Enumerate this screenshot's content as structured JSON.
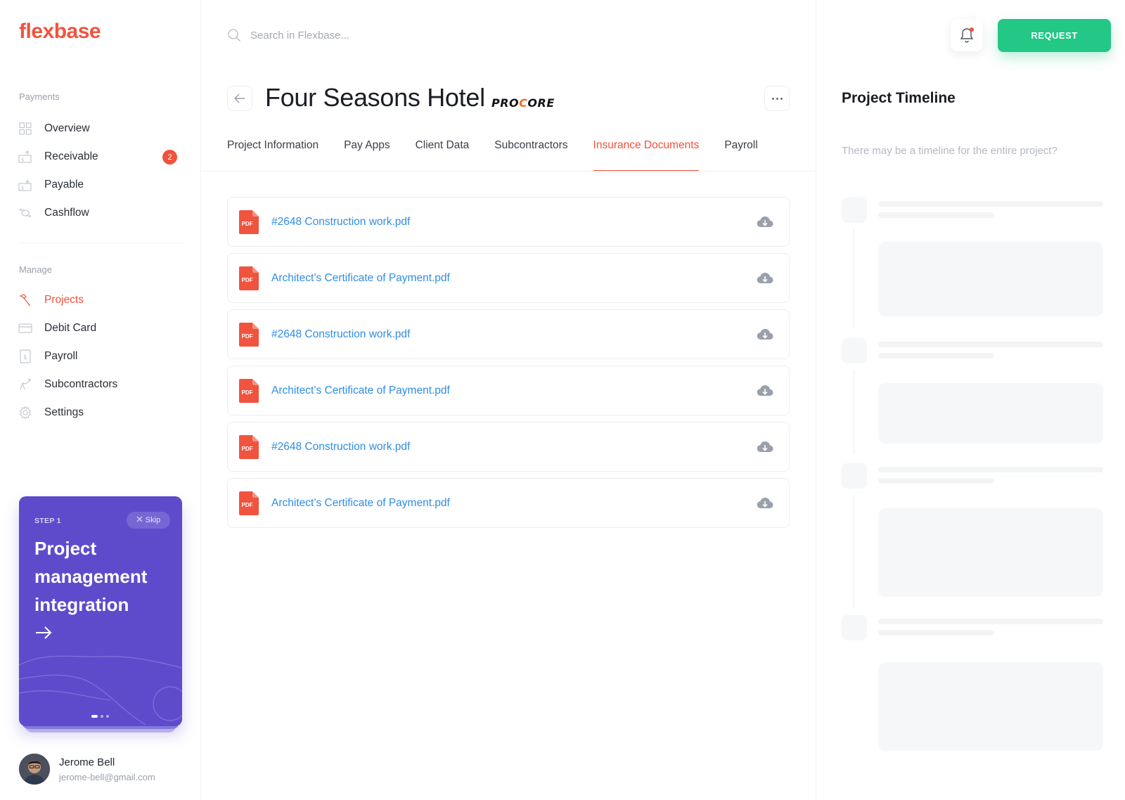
{
  "app": {
    "logo": "flexbase"
  },
  "sidebar": {
    "payments_title": "Payments",
    "payments": [
      {
        "label": "Overview",
        "icon": "grid-icon"
      },
      {
        "label": "Receivable",
        "icon": "receivable-icon",
        "badge": "2"
      },
      {
        "label": "Payable",
        "icon": "payable-icon"
      },
      {
        "label": "Cashflow",
        "icon": "cashflow-icon"
      }
    ],
    "manage_title": "Manage",
    "manage": [
      {
        "label": "Projects",
        "icon": "hammer-icon",
        "active": true
      },
      {
        "label": "Debit Card",
        "icon": "card-icon"
      },
      {
        "label": "Payroll",
        "icon": "payroll-icon"
      },
      {
        "label": "Subcontractors",
        "icon": "subcontractors-icon"
      },
      {
        "label": "Settings",
        "icon": "gear-icon"
      }
    ]
  },
  "promo": {
    "step": "STEP 1",
    "skip": "Skip",
    "title": "Project management integration"
  },
  "user": {
    "name": "Jerome Bell",
    "email": "jerome-bell@gmail.com"
  },
  "search": {
    "placeholder": "Search in Flexbase..."
  },
  "project": {
    "title": "Four Seasons Hotel",
    "brand_pre": "PRO",
    "brand_o": "C",
    "brand_post": "ORE"
  },
  "tabs": [
    {
      "label": "Project Information"
    },
    {
      "label": "Pay Apps"
    },
    {
      "label": "Client Data"
    },
    {
      "label": "Subcontractors"
    },
    {
      "label": "Insurance Documents",
      "active": true
    },
    {
      "label": "Payroll"
    }
  ],
  "documents": [
    {
      "name": "#2648 Construction work.pdf",
      "type": "PDF"
    },
    {
      "name": "Architect’s Certificate of Payment.pdf",
      "type": "PDF"
    },
    {
      "name": "#2648 Construction work.pdf",
      "type": "PDF"
    },
    {
      "name": "Architect’s Certificate of Payment.pdf",
      "type": "PDF"
    },
    {
      "name": "#2648 Construction work.pdf",
      "type": "PDF"
    },
    {
      "name": "Architect’s Certificate of Payment.pdf",
      "type": "PDF"
    }
  ],
  "right": {
    "request_label": "REQUEST",
    "timeline_title": "Project Timeline",
    "timeline_hint": "There may be a timeline for the entire project?"
  },
  "colors": {
    "accent": "#f0533e",
    "green": "#23c786",
    "purple": "#5e4bcc",
    "link": "#2f8de4"
  }
}
